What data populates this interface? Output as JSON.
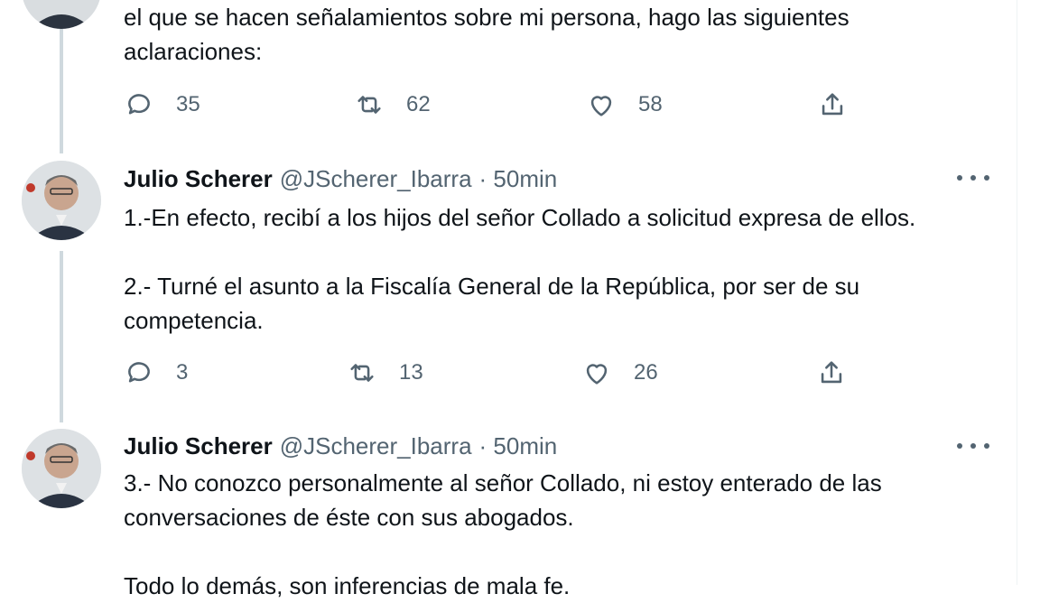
{
  "colors": {
    "text": "#0f1419",
    "secondary": "#536471",
    "thread_line": "#cfd9de"
  },
  "tweets": [
    {
      "text_lines": [
        "el que se hacen señalamientos sobre mi persona, hago las siguientes aclaraciones:"
      ],
      "actions": {
        "reply": "35",
        "retweet": "62",
        "like": "58"
      }
    },
    {
      "name": "Julio Scherer",
      "handle": "@JScherer_Ibarra",
      "time": "· 50min",
      "paragraphs": [
        "1.-En efecto, recibí a los hijos del señor Collado a solicitud expresa de ellos.",
        "2.- Turné el asunto a la Fiscalía General de la República, por ser de su competencia."
      ],
      "actions": {
        "reply": "3",
        "retweet": "13",
        "like": "26"
      }
    },
    {
      "name": "Julio Scherer",
      "handle": "@JScherer_Ibarra",
      "time": "· 50min",
      "paragraphs": [
        "3.- No conozco personalmente al señor Collado, ni estoy enterado de las conversaciones de éste con sus abogados.",
        "Todo lo demás, son inferencias de mala fe."
      ]
    }
  ],
  "icons": {
    "reply": "reply-icon",
    "retweet": "retweet-icon",
    "like": "heart-icon",
    "share": "share-icon",
    "more": "more-icon"
  }
}
